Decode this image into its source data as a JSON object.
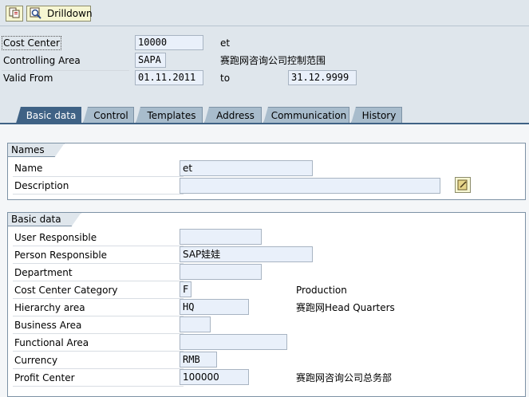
{
  "toolbar": {
    "icon1": "new-session-icon",
    "drilldown_icon": "magnifier-icon",
    "drilldown_label": "Drilldown"
  },
  "header": {
    "cost_center_label": "Cost Center",
    "cost_center_value": "10000",
    "cost_center_desc": "et",
    "controlling_area_label": "Controlling Area",
    "controlling_area_value": "SAPA",
    "controlling_area_desc": "赛跑网咨询公司控制范围",
    "valid_from_label": "Valid From",
    "valid_from_value": "01.11.2011",
    "to_label": "to",
    "valid_to_value": "31.12.9999"
  },
  "tabs": [
    {
      "label": "Basic data",
      "active": true
    },
    {
      "label": "Control",
      "active": false
    },
    {
      "label": "Templates",
      "active": false
    },
    {
      "label": "Address",
      "active": false
    },
    {
      "label": "Communication",
      "active": false
    },
    {
      "label": "History",
      "active": false
    }
  ],
  "names_group": {
    "title": "Names",
    "name_label": "Name",
    "name_value": "et",
    "description_label": "Description",
    "description_value": ""
  },
  "basic_group": {
    "title": "Basic data",
    "fields": [
      {
        "label": "User Responsible",
        "value": "",
        "desc": ""
      },
      {
        "label": "Person Responsible",
        "value": "SAP娃娃",
        "desc": ""
      },
      {
        "label": "Department",
        "value": "",
        "desc": ""
      },
      {
        "label": "Cost Center Category",
        "value": "F",
        "desc": "Production"
      },
      {
        "label": "Hierarchy area",
        "value": "HQ",
        "desc": "赛跑网Head Quarters"
      },
      {
        "label": "Business Area",
        "value": "",
        "desc": ""
      },
      {
        "label": "Functional Area",
        "value": "",
        "desc": ""
      },
      {
        "label": "Currency",
        "value": "RMB",
        "desc": ""
      },
      {
        "label": "Profit Center",
        "value": "100000",
        "desc": "赛跑网咨询公司总务部"
      }
    ]
  },
  "colors": {
    "background": "#dfe6ec",
    "active_tab": "#3f6285",
    "inactive_tab": "#a8bccc",
    "field_bg": "#e9f0fa"
  }
}
